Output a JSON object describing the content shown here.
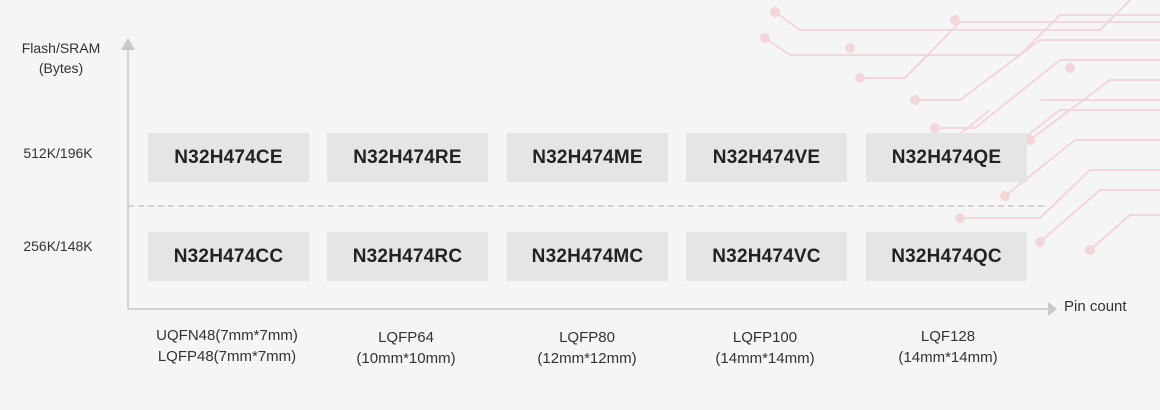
{
  "y_axis_title": [
    "Flash/SRAM",
    "(Bytes)"
  ],
  "x_axis_title": "Pin count",
  "memory_rows": [
    {
      "label": "512K/196K",
      "parts": [
        "N32H474CE",
        "N32H474RE",
        "N32H474ME",
        "N32H474VE",
        "N32H474QE"
      ]
    },
    {
      "label": "256K/148K",
      "parts": [
        "N32H474CC",
        "N32H474RC",
        "N32H474MC",
        "N32H474VC",
        "N32H474QC"
      ]
    }
  ],
  "packages": [
    [
      "UQFN48(7mm*7mm)",
      "LQFP48(7mm*7mm)"
    ],
    [
      "LQFP64",
      "(10mm*10mm)"
    ],
    [
      "LQFP80",
      "(12mm*12mm)"
    ],
    [
      "LQFP100",
      "(14mm*14mm)"
    ],
    [
      "LQF128",
      "(14mm*14mm)"
    ]
  ],
  "colors": {
    "background": "#f5f5f6",
    "chip_fill": "#e5e5e7",
    "axis": "#c8c8cc",
    "circuit_decoration": "#f3d4d8"
  }
}
